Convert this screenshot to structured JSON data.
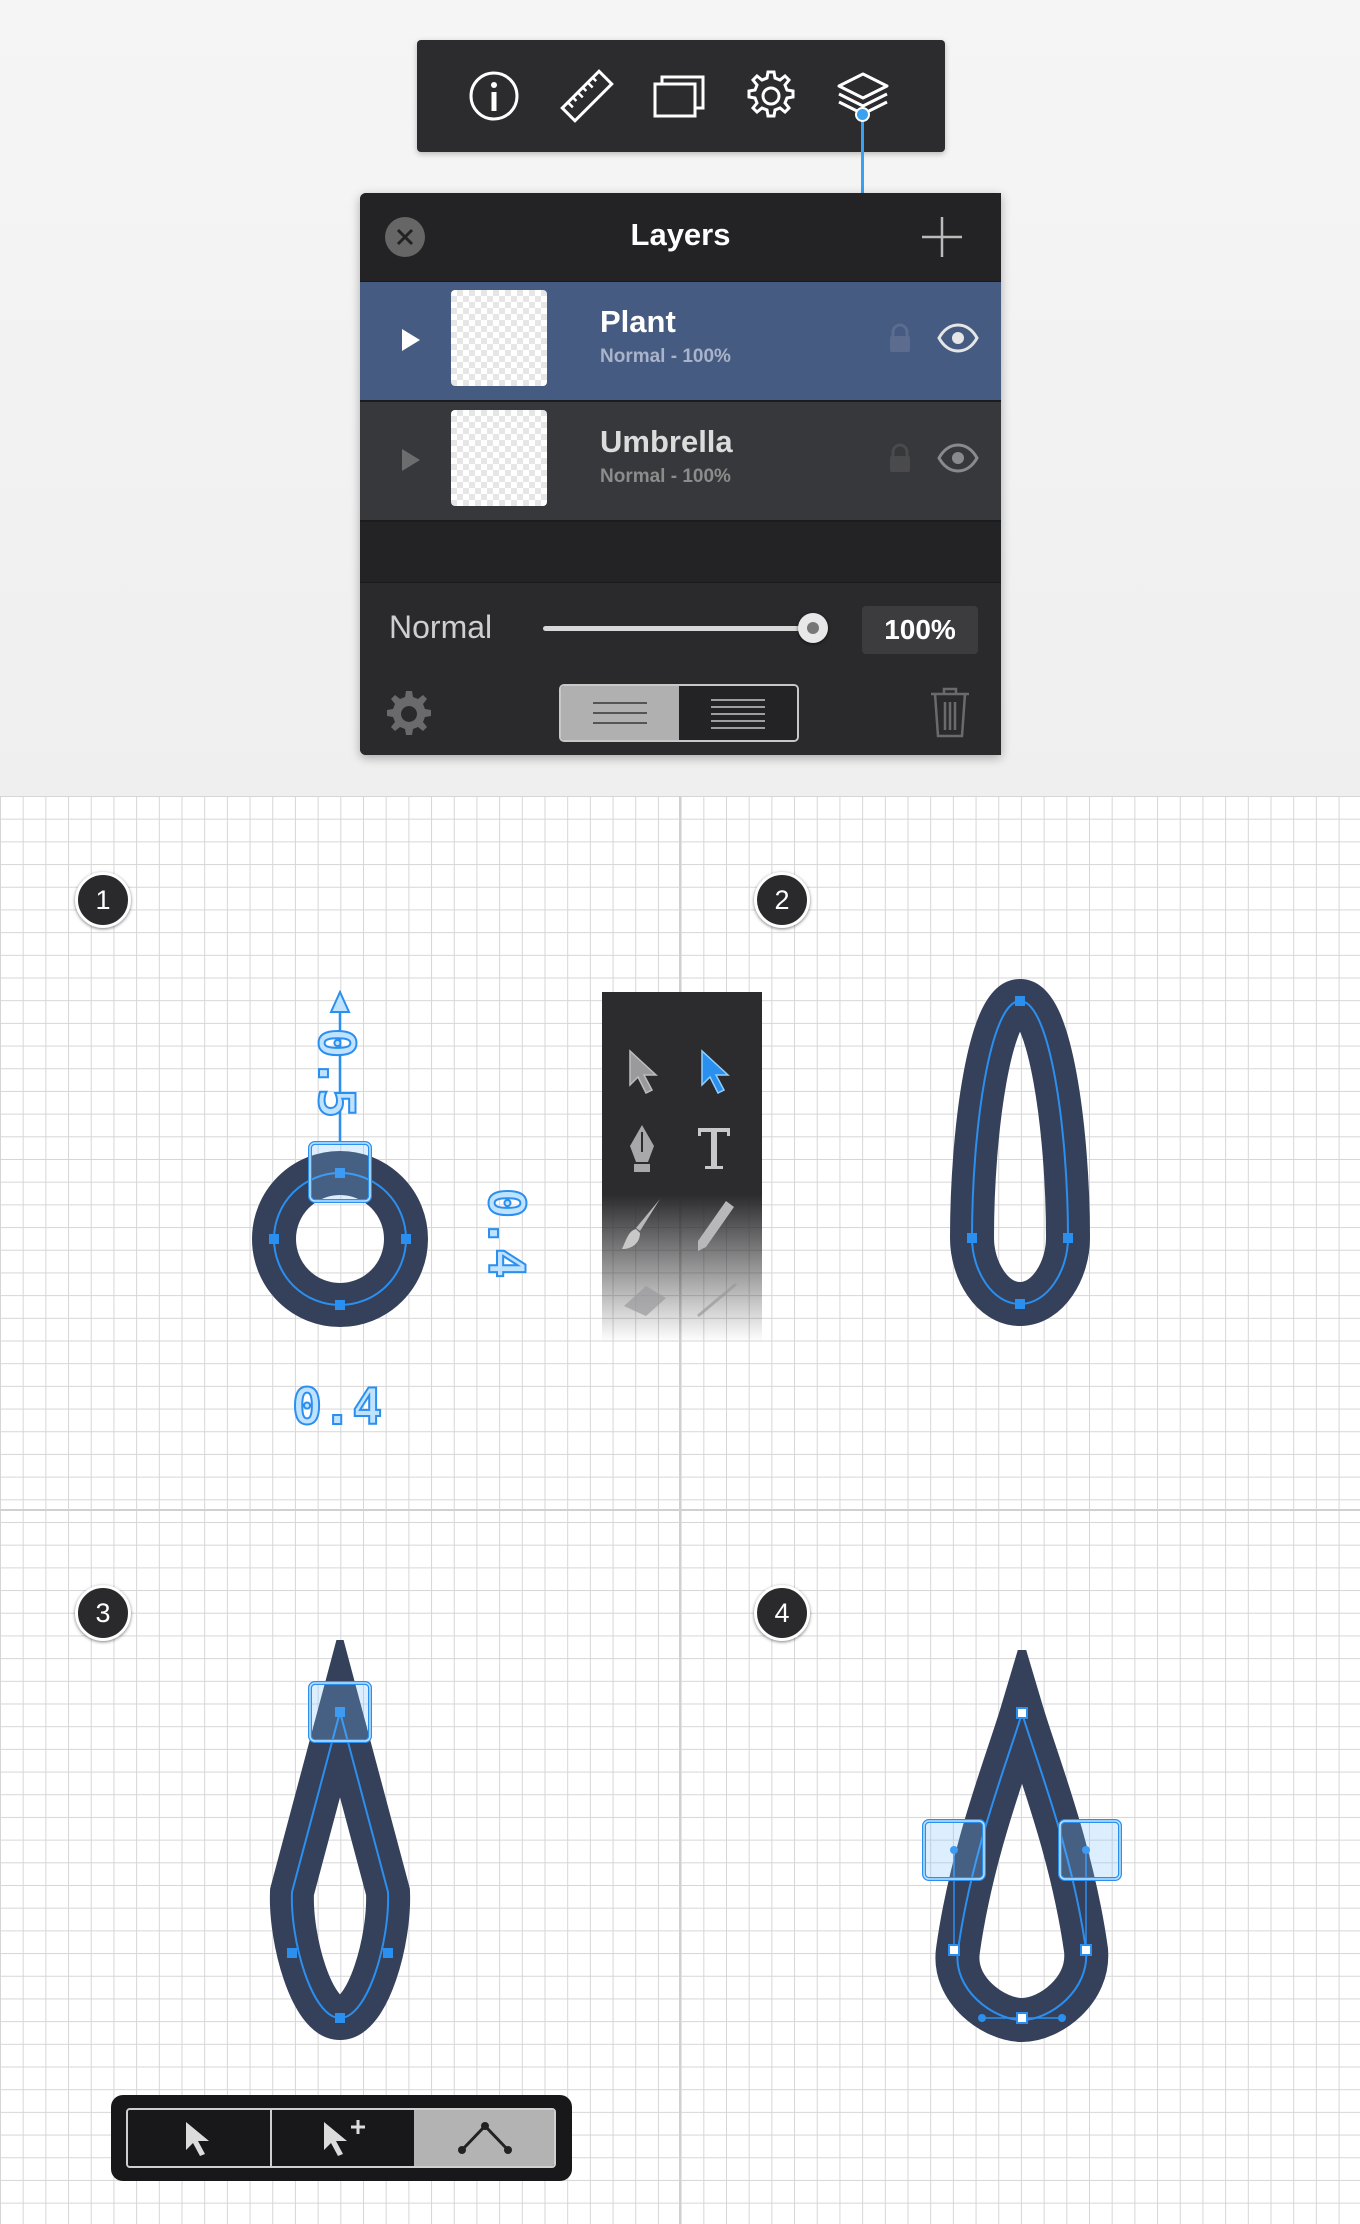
{
  "toolbar": {
    "icons": [
      "info-icon",
      "ruler-icon",
      "artboards-icon",
      "settings-gear-icon",
      "layers-icon"
    ],
    "active": "layers-icon"
  },
  "layers_panel": {
    "title": "Layers",
    "layers": [
      {
        "name": "Plant",
        "meta": "Normal - 100%",
        "selected": true
      },
      {
        "name": "Umbrella",
        "meta": "Normal - 100%",
        "selected": false
      }
    ],
    "blend_mode": "Normal",
    "opacity": "100%",
    "opacity_value": 1.0
  },
  "steps": {
    "s1": "1",
    "s2": "2",
    "s3": "3",
    "s4": "4"
  },
  "dimensions": {
    "top_move": "0.5",
    "width": "0.4",
    "height": "0.4"
  },
  "tools_panel": {
    "icons": [
      "select-arrow-icon",
      "direct-select-arrow-icon",
      "pen-icon",
      "text-icon",
      "brush-icon",
      "pencil-icon",
      "eraser-icon",
      "line-icon"
    ],
    "active": "direct-select-arrow-icon"
  },
  "node_toolbar": {
    "icons": [
      "select-node-icon",
      "add-node-icon",
      "corner-node-icon"
    ],
    "active": "corner-node-icon"
  },
  "colors": {
    "accent": "#3aa0f0",
    "shape_fill": "#35405a",
    "selected_layer": "#465b82",
    "panel_bg": "#232325"
  }
}
